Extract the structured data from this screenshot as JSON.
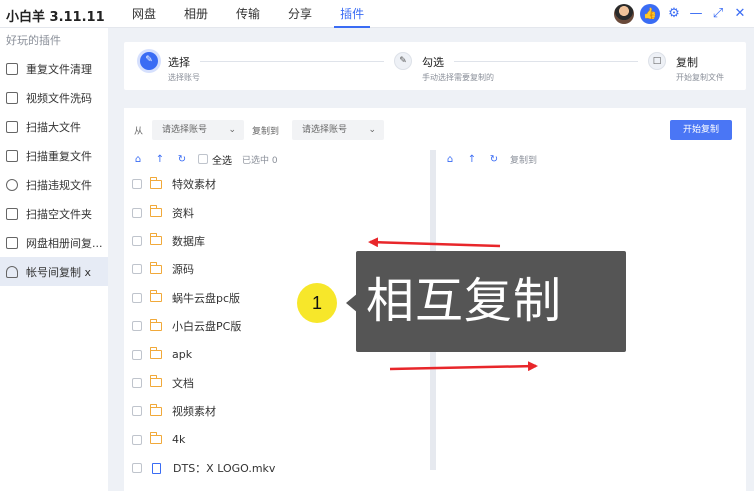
{
  "app": {
    "title": "小白羊 3.11.11"
  },
  "nav": {
    "items": [
      "网盘",
      "相册",
      "传输",
      "分享",
      "插件"
    ],
    "active_index": 4
  },
  "sidebar": {
    "heading": "好玩的插件",
    "items": [
      "重复文件清理",
      "视频文件洗码",
      "扫描大文件",
      "扫描重复文件",
      "扫描违规文件",
      "扫描空文件夹",
      "网盘相册间复...",
      "帐号间复制 x"
    ],
    "active_index": 7
  },
  "steps": [
    {
      "title": "选择",
      "sub": "选择账号",
      "icon": "edit-icon"
    },
    {
      "title": "勾选",
      "sub": "手动选择需要复制的",
      "icon": "check-square-icon"
    },
    {
      "title": "复制",
      "sub": "开始复制文件",
      "icon": "trash-icon"
    }
  ],
  "toolbar": {
    "from_label": "从",
    "from_placeholder": "请选择账号",
    "to_label": "复制到",
    "to_placeholder": "请选择账号",
    "start_label": "开始复制"
  },
  "left_pane": {
    "select_all": "全选",
    "selected": "已选中 0"
  },
  "right_pane": {
    "copy_to": "复制到"
  },
  "files": [
    {
      "name": "特效素材",
      "type": "folder"
    },
    {
      "name": "资料",
      "type": "folder"
    },
    {
      "name": "数据库",
      "type": "folder"
    },
    {
      "name": "源码",
      "type": "folder"
    },
    {
      "name": "蜗牛云盘pc版",
      "type": "folder"
    },
    {
      "name": "小白云盘PC版",
      "type": "folder"
    },
    {
      "name": "apk",
      "type": "folder"
    },
    {
      "name": "文档",
      "type": "folder"
    },
    {
      "name": "视频素材",
      "type": "folder"
    },
    {
      "name": "4k",
      "type": "folder"
    },
    {
      "name": "DTS：X LOGO.mkv",
      "type": "file"
    }
  ],
  "annotation": {
    "number": "1",
    "text": "相互复制",
    "arrow_color": "#e8262a"
  },
  "colors": {
    "accent": "#3a6cf4",
    "folder": "#f1a93a",
    "badge": "#f7e72a"
  }
}
